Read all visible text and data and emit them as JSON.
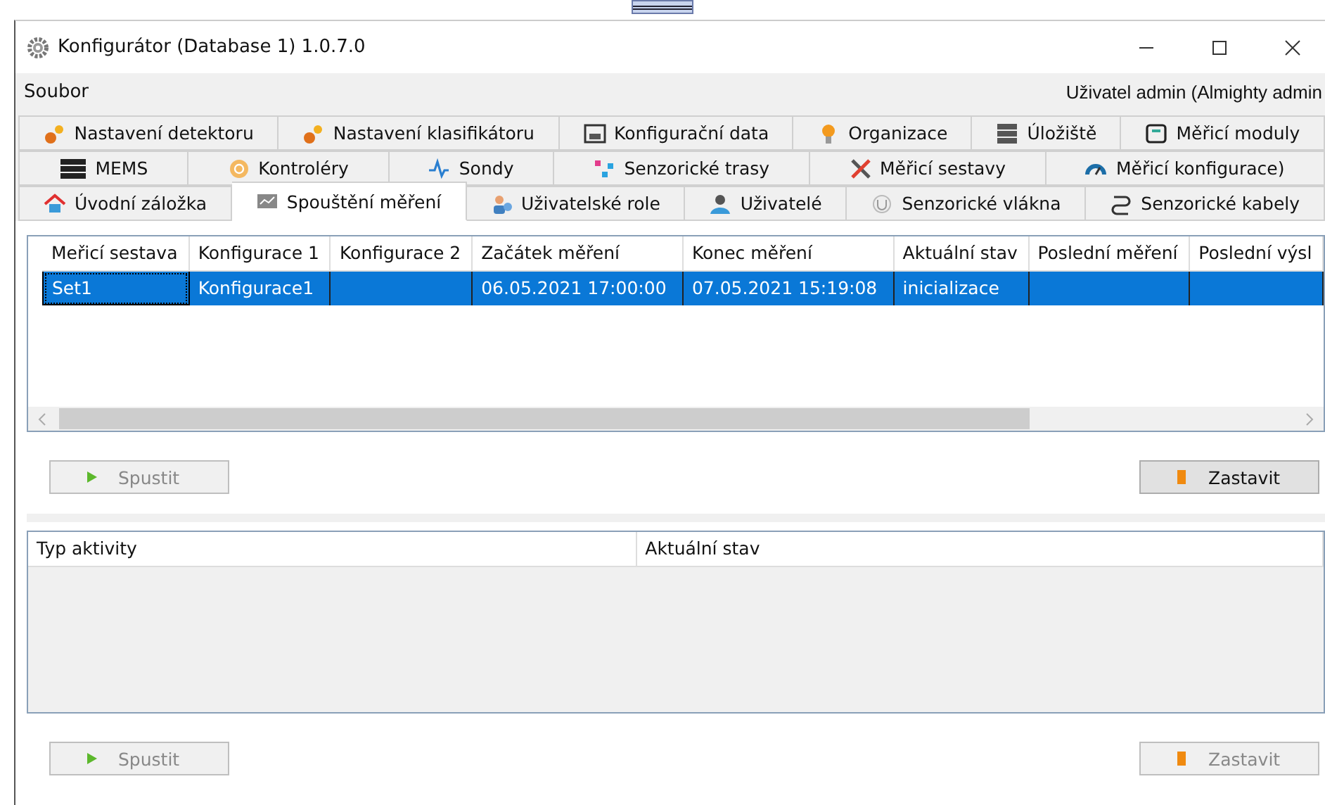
{
  "window": {
    "title": "Konfigurátor (Database 1) 1.0.7.0"
  },
  "menu": {
    "items": [
      "Soubor"
    ],
    "user": "Uživatel admin (Almighty admin"
  },
  "tab_rows": [
    {
      "tabs": [
        {
          "label": "Nastavení detektoru",
          "selected": false
        },
        {
          "label": "Nastavení klasifikátoru",
          "selected": false
        },
        {
          "label": "Konfigurační data",
          "selected": false
        },
        {
          "label": "Organizace",
          "selected": false
        },
        {
          "label": "Úložiště",
          "selected": false
        },
        {
          "label": "Měřicí moduly",
          "selected": false
        }
      ]
    },
    {
      "tabs": [
        {
          "label": "MEMS",
          "selected": false
        },
        {
          "label": "Kontroléry",
          "selected": false
        },
        {
          "label": "Sondy",
          "selected": false
        },
        {
          "label": "Senzorické trasy",
          "selected": false
        },
        {
          "label": "Měřicí sestavy",
          "selected": false
        },
        {
          "label": "Měřicí konfigurace)",
          "selected": false
        }
      ]
    },
    {
      "tabs": [
        {
          "label": "Úvodní záložka",
          "selected": false
        },
        {
          "label": "Spouštění měření",
          "selected": true
        },
        {
          "label": "Uživatelské role",
          "selected": false
        },
        {
          "label": "Uživatelé",
          "selected": false
        },
        {
          "label": "Senzorické vlákna",
          "selected": false
        },
        {
          "label": "Senzorické kabely",
          "selected": false
        }
      ]
    }
  ],
  "measurements_table": {
    "columns": [
      "Meřicí sestava",
      "Konfigurace 1",
      "Konfigurace 2",
      "Začátek měření",
      "Konec měření",
      "Aktuální stav",
      "Poslední měření",
      "Poslední výsl"
    ],
    "rows": [
      {
        "selected": true,
        "cells": [
          "Set1",
          "Konfigurace1",
          "",
          "06.05.2021 17:00:00",
          "07.05.2021 15:19:08",
          "inicializace",
          "",
          ""
        ]
      }
    ]
  },
  "measurements_buttons": [
    {
      "label": "Spustit",
      "kind": "start",
      "disabled": true
    },
    {
      "label": "Zastavit",
      "kind": "stop",
      "disabled": false
    }
  ],
  "activity_table": {
    "columns": [
      "Typ aktivity",
      "Aktuální stav"
    ]
  },
  "activity_buttons": [
    {
      "label": "Spustit",
      "kind": "start",
      "disabled": true
    },
    {
      "label": "Zastavit",
      "kind": "stop",
      "disabled": true
    }
  ]
}
